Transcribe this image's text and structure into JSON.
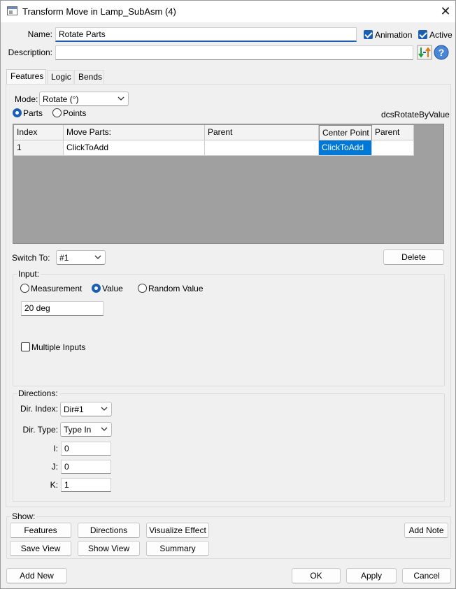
{
  "window": {
    "title": "Transform Move in Lamp_SubAsm (4)",
    "close_glyph": "✕"
  },
  "header": {
    "name_label": "Name:",
    "name_value": "Rotate Parts",
    "animation_label": "Animation",
    "animation_checked": true,
    "active_label": "Active",
    "active_checked": true,
    "description_label": "Description:",
    "description_value": "",
    "icons": [
      "refresh-arrows-icon",
      "help-icon"
    ],
    "help_glyph": "?"
  },
  "tabs": [
    {
      "label": "Features",
      "active": true
    },
    {
      "label": "Logic",
      "active": false
    },
    {
      "label": "Bends",
      "active": false
    }
  ],
  "features": {
    "mode_label": "Mode:",
    "mode_value": "Rotate (°)",
    "radio_parts_label": "Parts",
    "radio_points_label": "Points",
    "selected_radio": "Parts",
    "function_name": "dcsRotateByValue",
    "table": {
      "columns": [
        "Index",
        "Move Parts:",
        "Parent",
        "Center Point",
        "Parent"
      ],
      "rows": [
        [
          "1",
          "ClickToAdd",
          "",
          "ClickToAdd",
          ""
        ]
      ],
      "selected_cell": "Center Point"
    },
    "switch_to_label": "Switch To:",
    "switch_to_value": "#1",
    "delete_label": "Delete",
    "input": {
      "group_label": "Input:",
      "options": [
        "Measurement",
        "Value",
        "Random Value"
      ],
      "selected": "Value",
      "value": "20 deg",
      "multiple_inputs_label": "Multiple Inputs",
      "multiple_inputs_checked": false
    },
    "directions": {
      "group_label": "Directions:",
      "dir_index_label": "Dir. Index:",
      "dir_index_value": "Dir#1",
      "dir_type_label": "Dir. Type:",
      "dir_type_value": "Type In",
      "i_label": "I:",
      "i_value": "0",
      "j_label": "J:",
      "j_value": "0",
      "k_label": "K:",
      "k_value": "1"
    }
  },
  "show": {
    "group_label": "Show:",
    "buttons": [
      "Features",
      "Directions",
      "Visualize Effect",
      "Save View",
      "Show View",
      "Summary"
    ],
    "add_note_label": "Add Note"
  },
  "footer": {
    "add_new_label": "Add New",
    "ok_label": "OK",
    "apply_label": "Apply",
    "cancel_label": "Cancel"
  },
  "colors": {
    "accent": "#1a5fb4",
    "selection": "#0078d7",
    "grid_background": "#a0a0a0",
    "window_background": "#f0f0f0"
  }
}
